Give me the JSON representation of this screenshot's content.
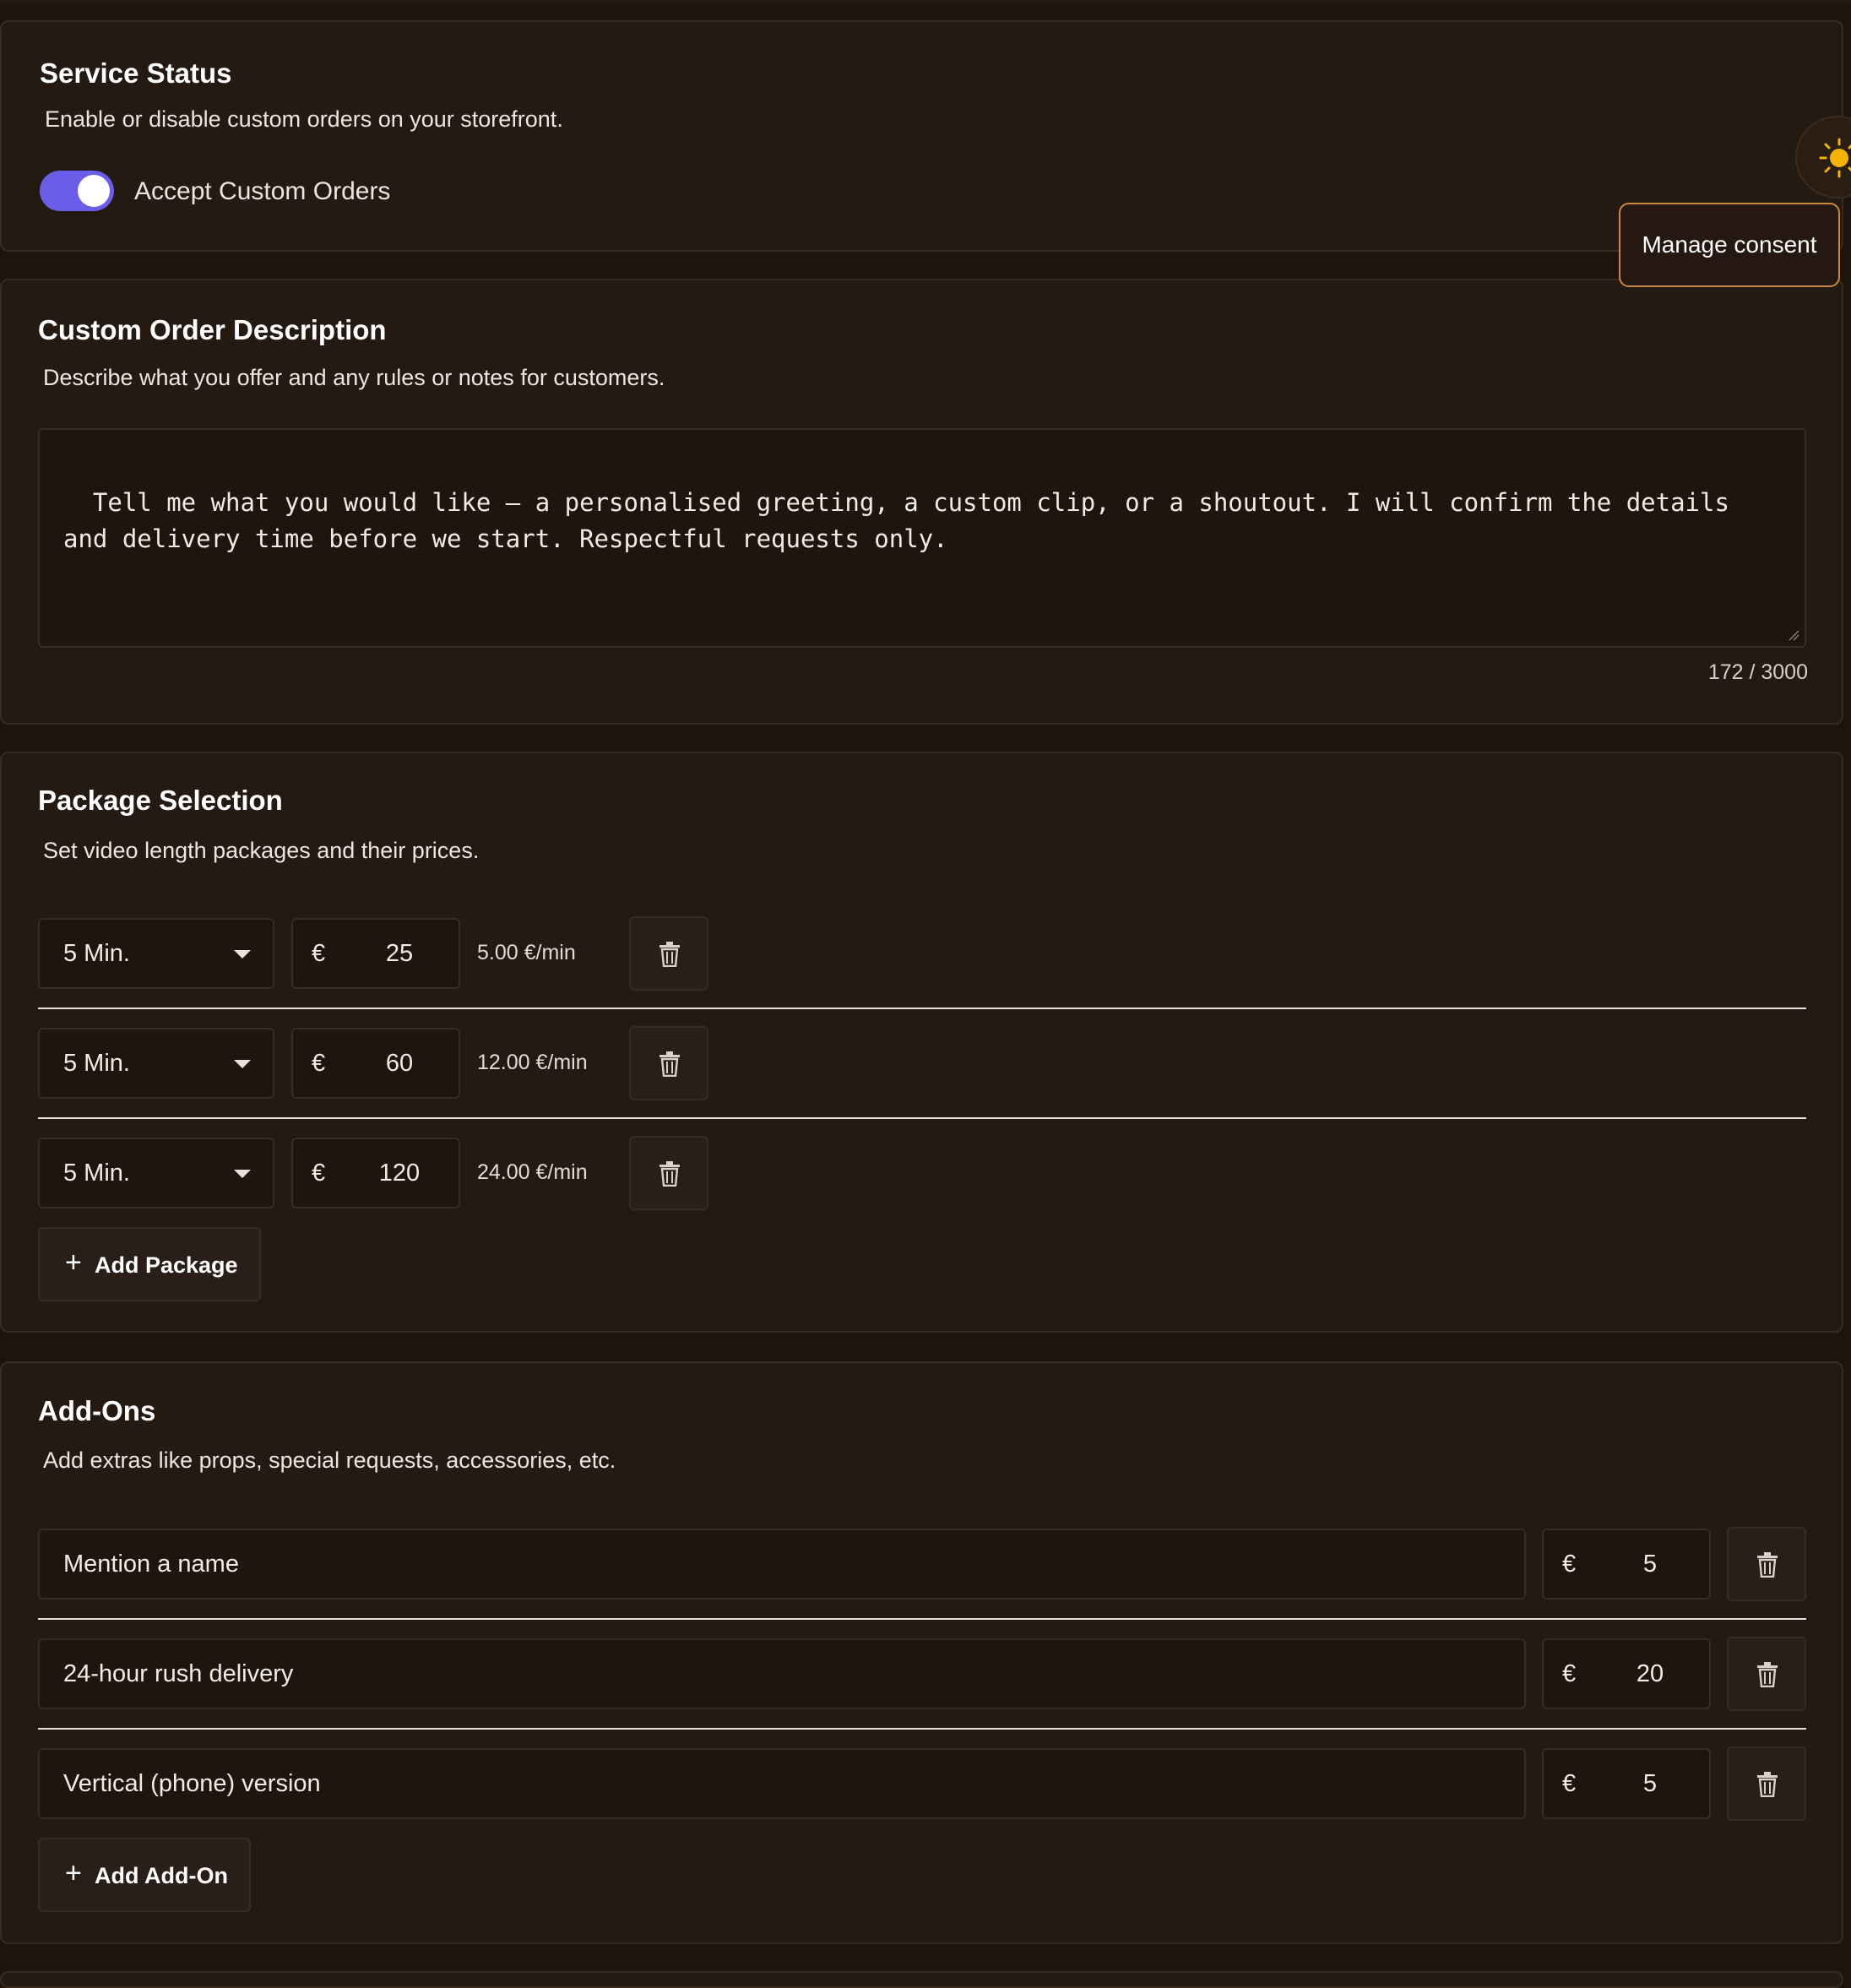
{
  "service_status": {
    "title": "Service Status",
    "subtitle": "Enable or disable custom orders on your storefront.",
    "toggle_label": "Accept Custom Orders",
    "toggle_on": true
  },
  "floating": {
    "theme_icon": "sun-icon",
    "consent_label": "Manage consent"
  },
  "description": {
    "title": "Custom Order Description",
    "subtitle": "Describe what you offer and any rules or notes for customers.",
    "text": "Tell me what you would like – a personalised greeting, a custom clip, or a shoutout. I will confirm the details and delivery time before we start. Respectful requests only.",
    "counter": "172 / 3000"
  },
  "packages": {
    "title": "Package Selection",
    "subtitle": "Set video length packages and their prices.",
    "currency": "€",
    "rows": [
      {
        "length": "5 Min.",
        "price": "25",
        "per_minute": "5.00 €/min"
      },
      {
        "length": "5 Min.",
        "price": "60",
        "per_minute": "12.00 €/min"
      },
      {
        "length": "5 Min.",
        "price": "120",
        "per_minute": "24.00 €/min"
      }
    ],
    "add_label": "Add Package"
  },
  "addons": {
    "title": "Add-Ons",
    "subtitle": "Add extras like props, special requests, accessories, etc.",
    "currency": "€",
    "rows": [
      {
        "name": "Mention a name",
        "price": "5"
      },
      {
        "name": "24-hour rush delivery",
        "price": "20"
      },
      {
        "name": "Vertical (phone) version",
        "price": "5"
      }
    ],
    "add_label": "Add Add-On"
  }
}
